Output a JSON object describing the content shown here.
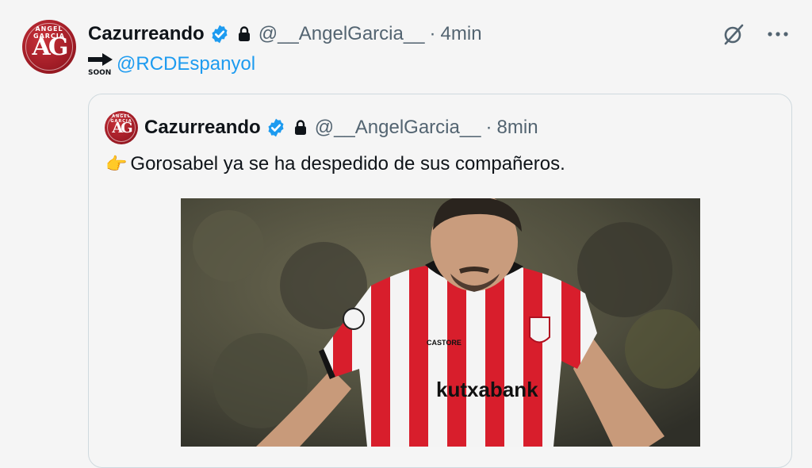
{
  "tweet": {
    "author": {
      "display_name": "Cazurreando",
      "handle": "@__AngelGarcia__",
      "avatar_monogram": "AG",
      "avatar_arc_text": "ANGEL GARCIA"
    },
    "separator": "·",
    "time": "4min",
    "soon_label": "SOON",
    "mention": "@RCDEspanyol",
    "actions": {
      "grok_icon": "slash-circle-icon",
      "more_icon": "more-dots-icon"
    }
  },
  "quoted_tweet": {
    "author": {
      "display_name": "Cazurreando",
      "handle": "@__AngelGarcia__",
      "avatar_monogram": "AG",
      "avatar_arc_text": "ANGEL GARCIA"
    },
    "separator": "·",
    "time": "8min",
    "emoji": "👉",
    "text": "Gorosabel ya se ha despedido de sus compañeros.",
    "media": {
      "sponsor_text": "kutxabank",
      "kit_brand_text": "CASTORE",
      "shirt_colors": [
        "#d81e2c",
        "#ffffff"
      ]
    }
  },
  "colors": {
    "verified": "#1d9bf0",
    "link": "#1d9bf0",
    "muted": "#536471",
    "brand_red": "#a01c26"
  }
}
